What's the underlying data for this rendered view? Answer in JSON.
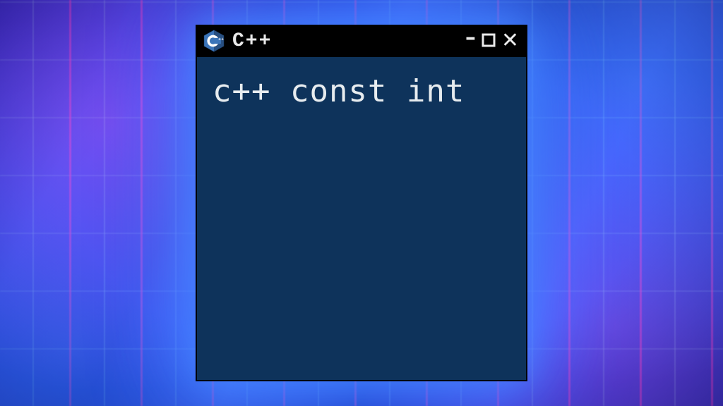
{
  "window": {
    "title": "C++",
    "logo_name": "cpp-logo-icon",
    "controls": {
      "minimize_glyph": "–",
      "close_glyph": "✕"
    }
  },
  "editor": {
    "text": "c++ const int"
  },
  "colors": {
    "titlebar_bg": "#000000",
    "content_bg": "#0e335b",
    "text": "#e7ecef"
  }
}
